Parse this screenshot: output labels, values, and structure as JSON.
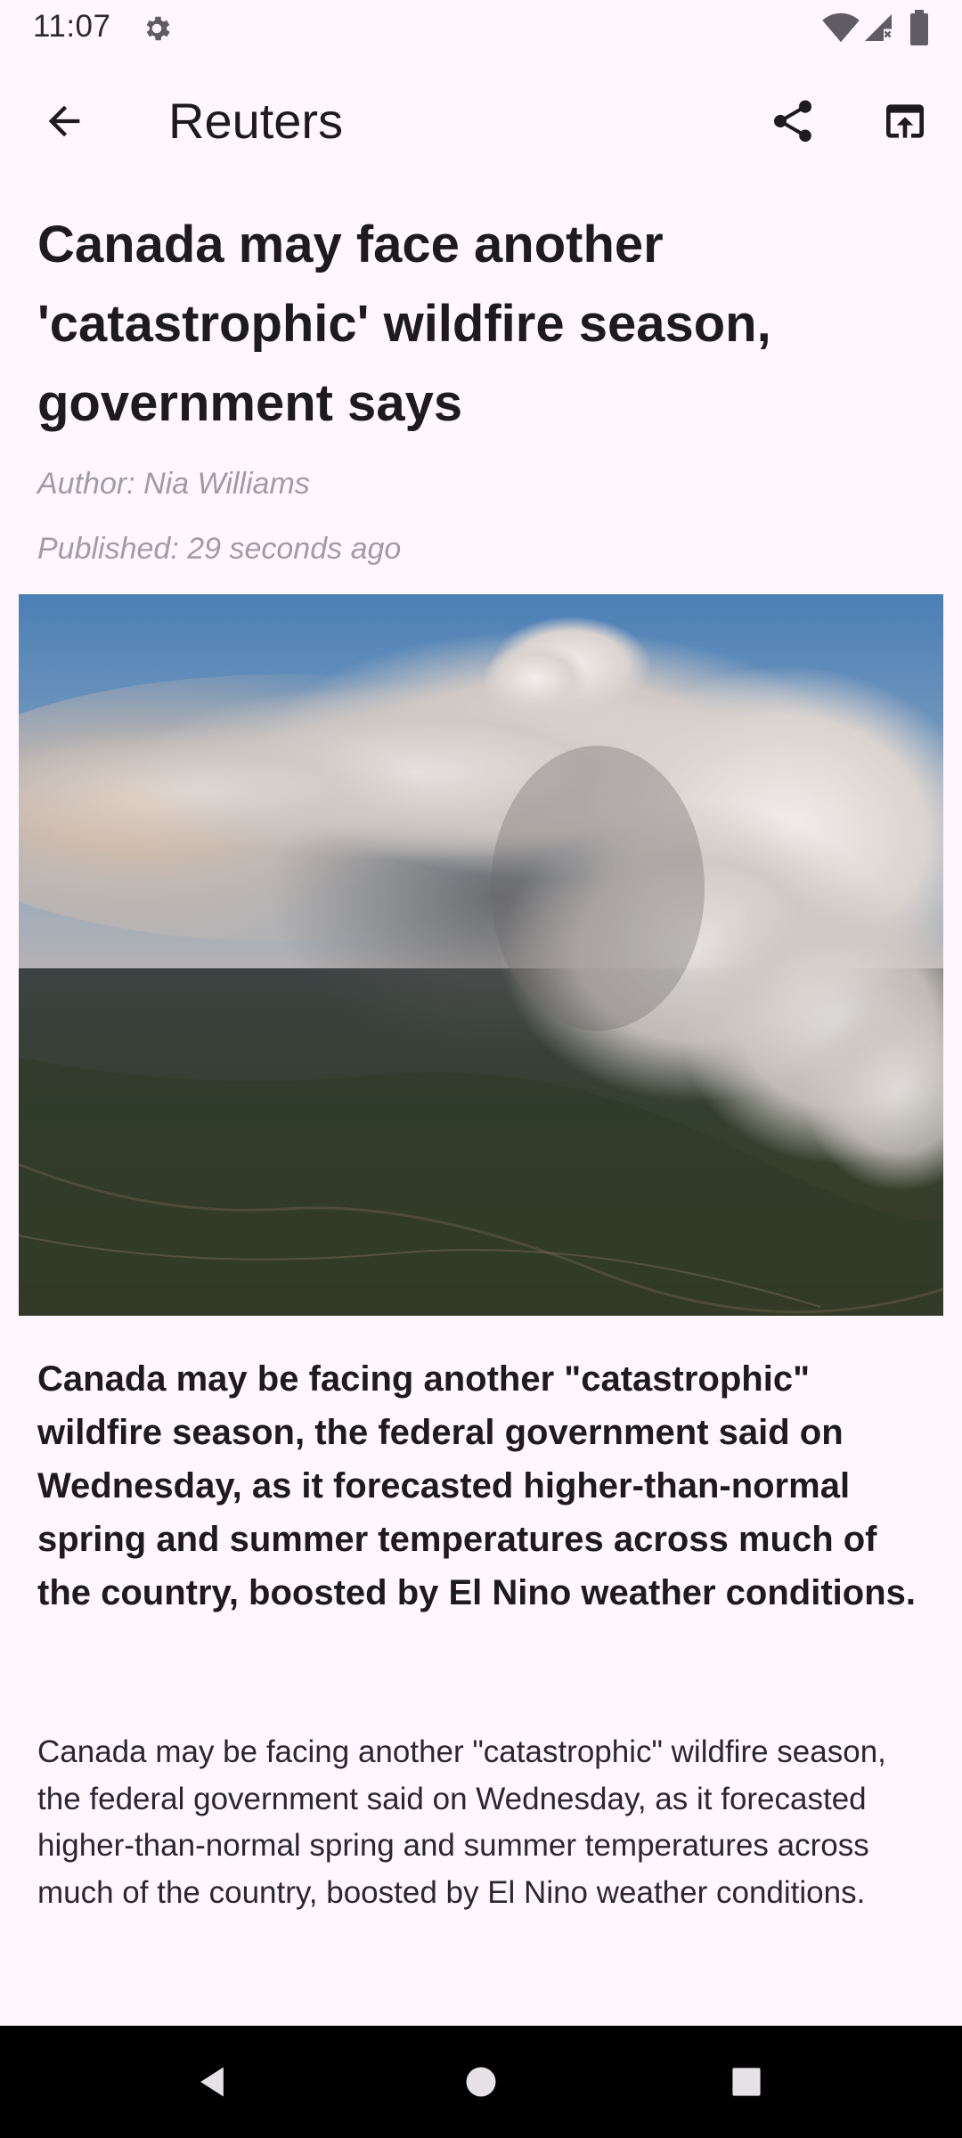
{
  "status_bar": {
    "time": "11:07",
    "icons": [
      "gear-icon",
      "wifi-icon",
      "signal-icon",
      "battery-icon"
    ]
  },
  "app_bar": {
    "title": "Reuters",
    "back_icon": "arrow-left-icon",
    "share_icon": "share-icon",
    "open_icon": "open-in-browser-icon"
  },
  "article": {
    "headline": "Canada may face another 'catastrophic' wildfire season, government says",
    "author": "Author: Nia Williams",
    "published": "Published: 29 seconds ago",
    "lead": "Canada may be facing another \"catastrophic\" wildfire season, the federal government said on Wednesday, as it forecasted higher-than-normal spring and summer temperatures across much of the country, boosted by El Nino weather conditions.",
    "body": "Canada may be facing another \"catastrophic\" wildfire season, the federal government said on Wednesday, as it forecasted higher-than-normal spring and summer temperatures across much of the country, boosted by El Nino weather conditions."
  },
  "nav_bar": {
    "icons": [
      "nav-back-icon",
      "nav-home-icon",
      "nav-recents-icon"
    ]
  },
  "colors": {
    "background": "#FFF7FD",
    "text": "#1D1B20",
    "meta": "#A09CA3",
    "nav_bar": "#000000"
  }
}
